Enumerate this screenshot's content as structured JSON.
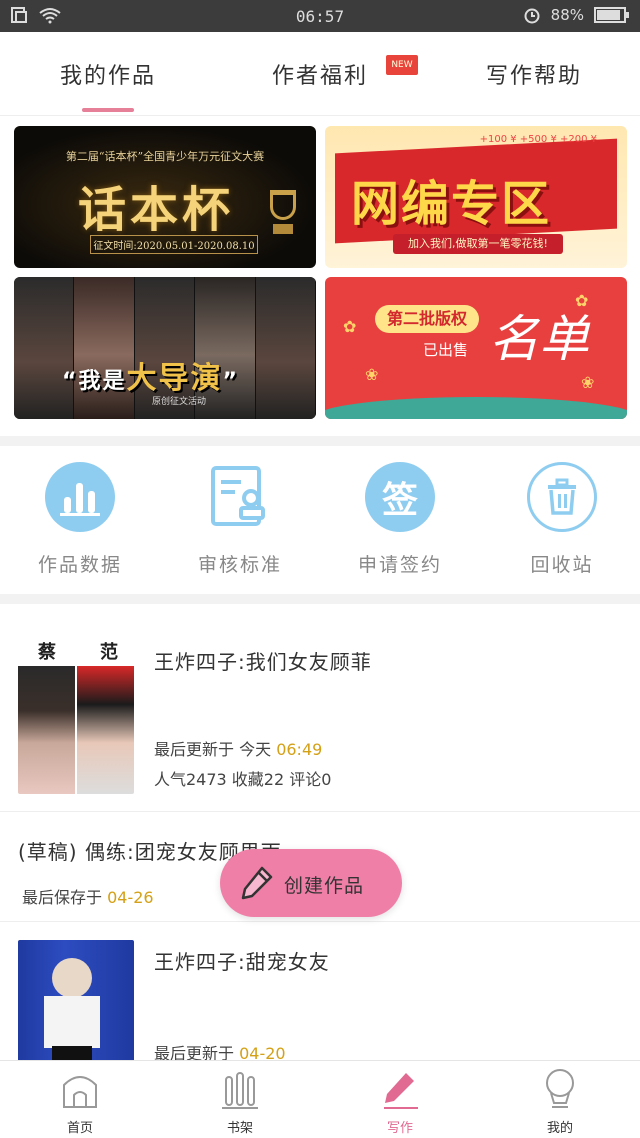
{
  "status_bar": {
    "time": "06:57",
    "battery": "88%"
  },
  "tabs": [
    {
      "label": "我的作品",
      "active": true
    },
    {
      "label": "作者福利",
      "badge": "NEW"
    },
    {
      "label": "写作帮助"
    }
  ],
  "banners": {
    "b1": {
      "subtitle": "第二届“话本杯”全国青少年万元征文大赛",
      "title": "话本杯",
      "date": "征文时间:2020.05.01-2020.08.10"
    },
    "b2": {
      "small": "+100 ¥  +500 ¥  +200 ¥",
      "title": "网编专区",
      "ribbon": "加入我们,做取第一笔零花钱!"
    },
    "b3": {
      "quote_open": "“我是",
      "highlight": "大导演",
      "quote_close": "”",
      "small": "原创征文活动"
    },
    "b4": {
      "pill": "第二批版权",
      "line2": "已出售",
      "title": "名单"
    }
  },
  "actions": [
    {
      "label": "作品数据",
      "icon": "bar-chart-icon",
      "color": "#8fcdf0"
    },
    {
      "label": "审核标准",
      "icon": "document-stamp-icon",
      "color": "#8fcdf0"
    },
    {
      "label": "申请签约",
      "icon": "sign-icon",
      "color": "#8fcdf0",
      "glyph": "签"
    },
    {
      "label": "回收站",
      "icon": "trash-icon",
      "color": "#8fcdf0"
    }
  ],
  "works": [
    {
      "thumb_caption_left": "蔡",
      "thumb_caption_right": "范",
      "title": "王炸四子:我们女友顾菲",
      "updated_prefix": "最后更新于 今天 ",
      "updated_time": "06:49",
      "stats": "人气2473 收藏22 评论0"
    },
    {
      "title": "(草稿) 偶练:团宠女友顾思雨",
      "saved_prefix": "最后保存于 ",
      "saved_time": "04-26"
    },
    {
      "title": "王炸四子:甜宠女友",
      "updated_prefix": "最后更新于 ",
      "updated_time": "04-20"
    }
  ],
  "fab": {
    "label": "创建作品"
  },
  "bottom_nav": [
    {
      "label": "首页",
      "icon": "home-icon"
    },
    {
      "label": "书架",
      "icon": "bookshelf-icon"
    },
    {
      "label": "写作",
      "icon": "pen-icon",
      "active": true
    },
    {
      "label": "我的",
      "icon": "profile-icon"
    }
  ],
  "colors": {
    "accent": "#e67f98",
    "action_icon": "#8fcdf0",
    "highlight_time": "#d4a016",
    "fab": "#f07fa8"
  }
}
